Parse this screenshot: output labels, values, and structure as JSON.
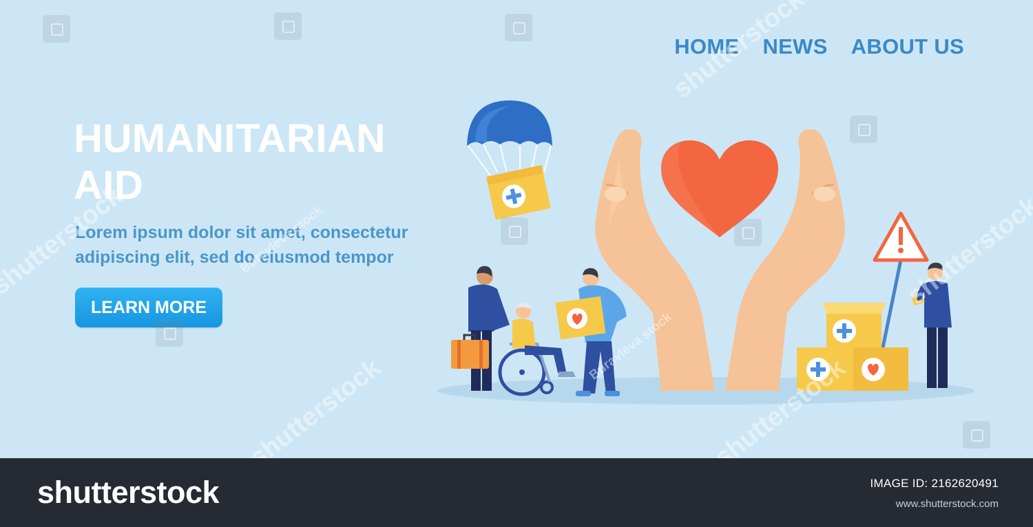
{
  "nav": {
    "items": [
      "HOME",
      "NEWS",
      "ABOUT US"
    ]
  },
  "hero": {
    "title": "HUMANITARIAN AID",
    "description": "Lorem ipsum dolor sit amet, consectetur adipiscing elit, sed do eiusmod tempor",
    "cta_label": "LEARN MORE"
  },
  "illustration": {
    "icons": [
      "parachute-icon",
      "aid-box-icon",
      "heart-icon",
      "hand-icon",
      "warning-sign-icon",
      "wheelchair-icon",
      "suitcase-icon",
      "medical-cross-icon"
    ]
  },
  "watermark": {
    "brand": "shutterstock",
    "author": "Buravleva stock"
  },
  "footer": {
    "logo": "shutterstock",
    "image_id": "IMAGE ID: 2162620491",
    "site": "www.shutterstock.com"
  },
  "colors": {
    "background": "#cde6f5",
    "nav_text": "#3b89c6",
    "body_text": "#4a97ca",
    "button": "#1f9fe6",
    "heart": "#f3663f",
    "box": "#f6c94b",
    "footer": "#262a33"
  }
}
